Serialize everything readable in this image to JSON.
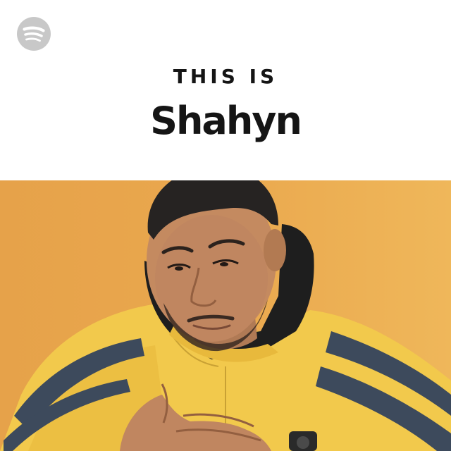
{
  "cover": {
    "eyebrow": "THIS IS",
    "artist_name": "Shahyn",
    "logo_icon": "spotify-logo-icon",
    "photo_subject": "artist-portrait",
    "colors": {
      "top_background": "#ffffff",
      "photo_background": "#e9a94c",
      "text": "#151515",
      "logo": "#c8c8c8",
      "jacket_yellow": "#f2c94c",
      "jacket_stripe": "#3d4a5c",
      "hoodie": "#1e1e1e"
    }
  }
}
